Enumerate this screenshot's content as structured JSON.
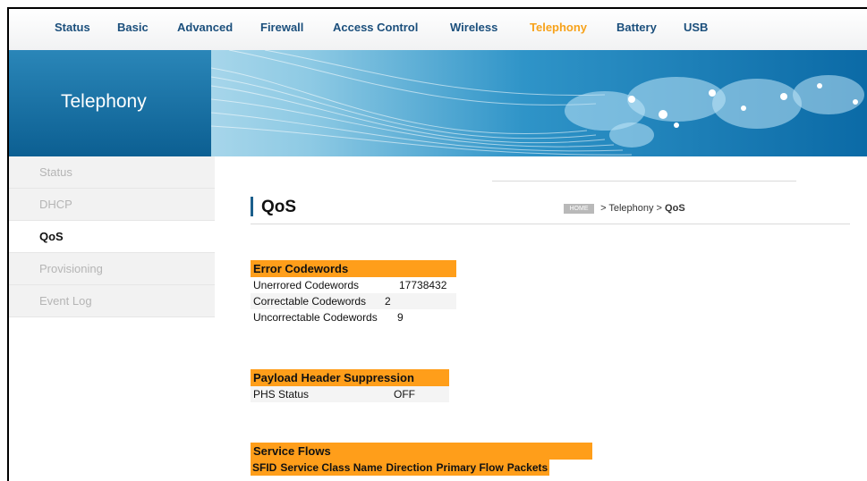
{
  "nav": {
    "items": [
      "Status",
      "Basic",
      "Advanced",
      "Firewall",
      "Access Control",
      "Wireless",
      "Telephony",
      "Battery",
      "USB"
    ],
    "active_index": 6,
    "active_color": "#f7a21a"
  },
  "banner": {
    "title": "Telephony"
  },
  "sidebar": {
    "items": [
      "Status",
      "DHCP",
      "QoS",
      "Provisioning",
      "Event Log"
    ],
    "active_index": 2
  },
  "page": {
    "title": "QoS",
    "breadcrumb": {
      "home": "HOME",
      "path": "> Telephony >",
      "current": "QoS"
    }
  },
  "error_codewords": {
    "heading": "Error Codewords",
    "rows": [
      {
        "label": "Unerrored Codewords",
        "value": "17738432"
      },
      {
        "label": "Correctable Codewords",
        "value": "2"
      },
      {
        "label": "Uncorrectable Codewords",
        "value": "9"
      }
    ]
  },
  "phs": {
    "heading": "Payload Header Suppression",
    "rows": [
      {
        "label": "PHS Status",
        "value": "OFF"
      }
    ]
  },
  "service_flows": {
    "heading": "Service Flows",
    "columns": [
      "SFID",
      "Service Class Name",
      "Direction",
      "Primary Flow",
      "Packets"
    ]
  },
  "colors": {
    "accent": "#ff9e1a",
    "nav_text": "#1b4f7c",
    "banner": "#0b6aa6"
  }
}
